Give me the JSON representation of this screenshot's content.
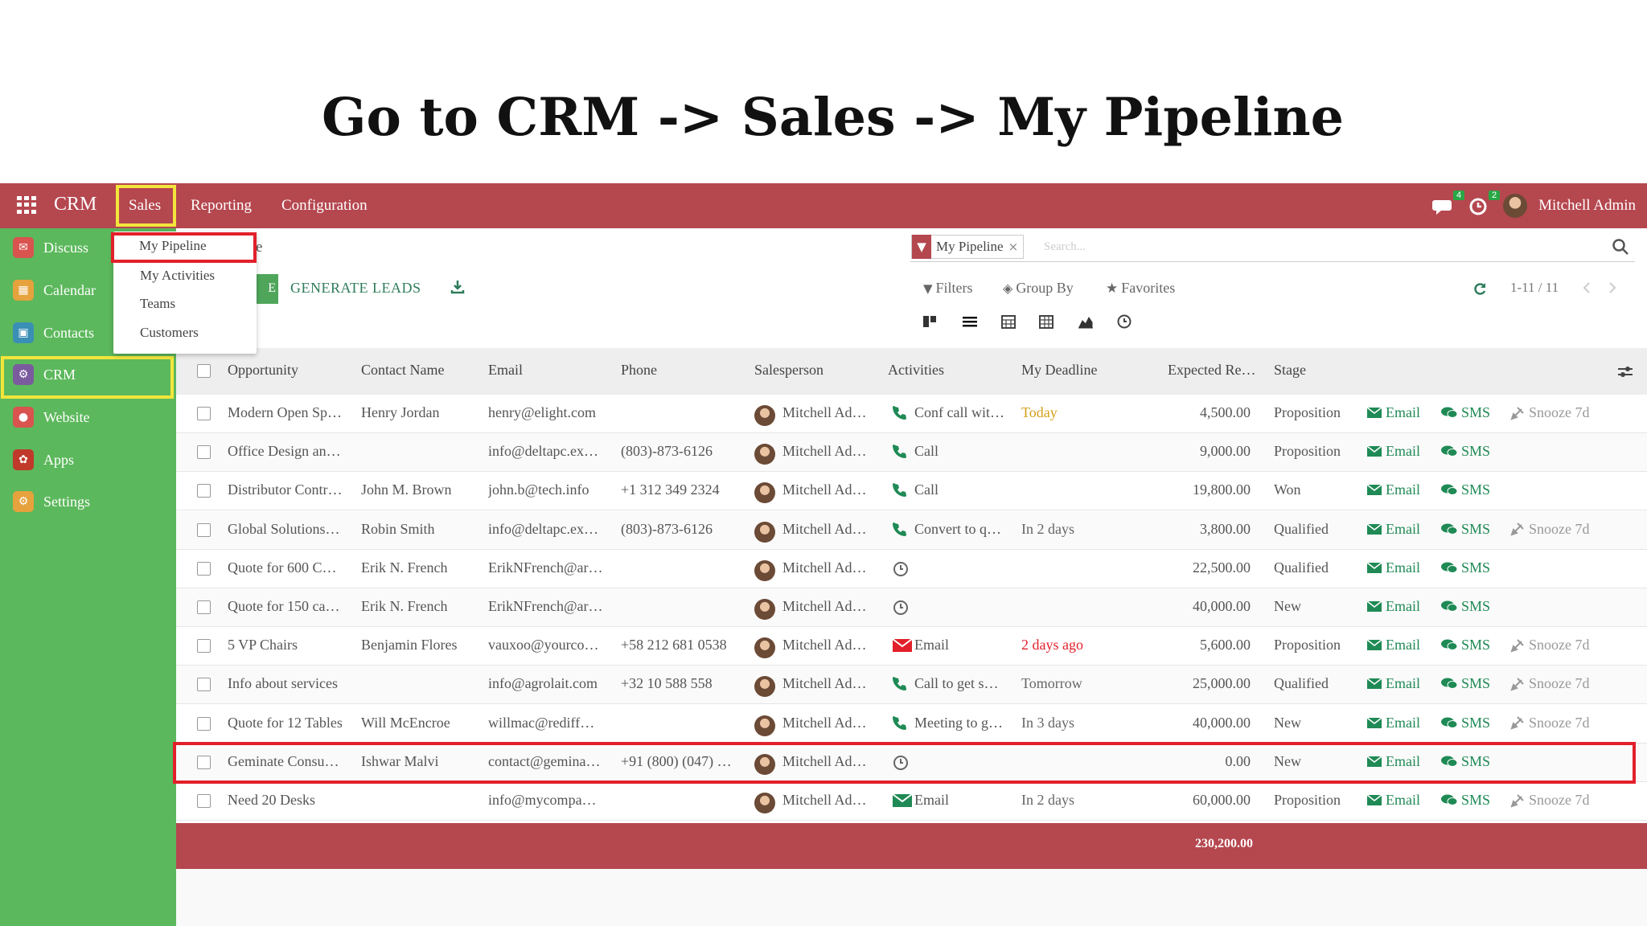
{
  "slide": {
    "title": "Go to CRM -> Sales -> My Pipeline"
  },
  "topbar": {
    "app_name": "CRM",
    "menus": [
      "Sales",
      "Reporting",
      "Configuration"
    ],
    "messages_count": "4",
    "activities_count": "2",
    "user": "Mitchell Admin"
  },
  "dropdown": {
    "items": [
      "My Pipeline",
      "My Activities",
      "Teams",
      "Customers"
    ]
  },
  "sidebar": {
    "items": [
      {
        "label": "Discuss",
        "icon": "discuss-icon",
        "color": "#d9534f"
      },
      {
        "label": "Calendar",
        "icon": "calendar-icon",
        "color": "#e6a23c"
      },
      {
        "label": "Contacts",
        "icon": "contacts-icon",
        "color": "#3a8fb5"
      },
      {
        "label": "CRM",
        "icon": "crm-icon",
        "color": "#7a5c9e"
      },
      {
        "label": "Website",
        "icon": "website-icon",
        "color": "#d9534f"
      },
      {
        "label": "Apps",
        "icon": "apps-icon",
        "color": "#c0392b"
      },
      {
        "label": "Settings",
        "icon": "settings-icon",
        "color": "#e6a23c"
      }
    ]
  },
  "control": {
    "breadcrumb_tail": "e",
    "create_label": "E",
    "generate_leads": "GENERATE LEADS",
    "facet": "My Pipeline",
    "search_placeholder": "Search...",
    "filters": "Filters",
    "group_by": "Group By",
    "favorites": "Favorites",
    "pager": "1-11 / 11"
  },
  "table": {
    "headers": [
      "Opportunity",
      "Contact Name",
      "Email",
      "Phone",
      "Salesperson",
      "Activities",
      "My Deadline",
      "Expected Re…",
      "Stage"
    ],
    "rows": [
      {
        "opportunity": "Modern Open Sp…",
        "contact": "Henry Jordan",
        "email": "henry@elight.com",
        "phone": "",
        "salesperson": "Mitchell Ad…",
        "activity_icon": "phone-icon",
        "activity": "Conf call wit…",
        "deadline": "Today",
        "deadline_color": "#d4a017",
        "revenue": "4,500.00",
        "stage": "Proposition",
        "snooze": "Snooze 7d"
      },
      {
        "opportunity": "Office Design an…",
        "contact": "",
        "email": "info@deltapc.ex…",
        "phone": "(803)-873-6126",
        "salesperson": "Mitchell Ad…",
        "activity_icon": "phone-icon",
        "activity": "Call",
        "deadline": "",
        "deadline_color": "#666666",
        "revenue": "9,000.00",
        "stage": "Proposition",
        "snooze": ""
      },
      {
        "opportunity": "Distributor Contr…",
        "contact": "John M. Brown",
        "email": "john.b@tech.info",
        "phone": "+1 312 349 2324",
        "salesperson": "Mitchell Ad…",
        "activity_icon": "phone-icon",
        "activity": "Call",
        "deadline": "",
        "deadline_color": "#666666",
        "revenue": "19,800.00",
        "stage": "Won",
        "snooze": ""
      },
      {
        "opportunity": "Global Solutions…",
        "contact": "Robin Smith",
        "email": "info@deltapc.ex…",
        "phone": "(803)-873-6126",
        "salesperson": "Mitchell Ad…",
        "activity_icon": "phone-icon",
        "activity": "Convert to q…",
        "deadline": "In 2 days",
        "deadline_color": "#666666",
        "revenue": "3,800.00",
        "stage": "Qualified",
        "snooze": "Snooze 7d"
      },
      {
        "opportunity": "Quote for 600 C…",
        "contact": "Erik N. French",
        "email": "ErikNFrench@ar…",
        "phone": "",
        "salesperson": "Mitchell Ad…",
        "activity_icon": "clock-icon",
        "activity": "",
        "deadline": "",
        "deadline_color": "#666666",
        "revenue": "22,500.00",
        "stage": "Qualified",
        "snooze": ""
      },
      {
        "opportunity": "Quote for 150 ca…",
        "contact": "Erik N. French",
        "email": "ErikNFrench@ar…",
        "phone": "",
        "salesperson": "Mitchell Ad…",
        "activity_icon": "clock-icon",
        "activity": "",
        "deadline": "",
        "deadline_color": "#666666",
        "revenue": "40,000.00",
        "stage": "New",
        "snooze": ""
      },
      {
        "opportunity": "5 VP Chairs",
        "contact": "Benjamin Flores",
        "email": "vauxoo@yourco…",
        "phone": "+58 212 681 0538",
        "salesperson": "Mitchell Ad…",
        "activity_icon": "email-red-icon",
        "activity": "Email",
        "deadline": "2 days ago",
        "deadline_color": "#e2202b",
        "revenue": "5,600.00",
        "stage": "Proposition",
        "snooze": "Snooze 7d"
      },
      {
        "opportunity": "Info about services",
        "contact": "",
        "email": "info@agrolait.com",
        "phone": "+32 10 588 558",
        "salesperson": "Mitchell Ad…",
        "activity_icon": "phone-icon",
        "activity": "Call to get s…",
        "deadline": "Tomorrow",
        "deadline_color": "#666666",
        "revenue": "25,000.00",
        "stage": "Qualified",
        "snooze": "Snooze 7d"
      },
      {
        "opportunity": "Quote for 12 Tables",
        "contact": "Will McEncroe",
        "email": "willmac@rediff…",
        "phone": "",
        "salesperson": "Mitchell Ad…",
        "activity_icon": "phone-icon",
        "activity": "Meeting to g…",
        "deadline": "In 3 days",
        "deadline_color": "#666666",
        "revenue": "40,000.00",
        "stage": "New",
        "snooze": "Snooze 7d"
      },
      {
        "opportunity": "Geminate Consu…",
        "contact": "Ishwar Malvi",
        "email": "contact@gemina…",
        "phone": "+91 (800) (047) …",
        "salesperson": "Mitchell Ad…",
        "activity_icon": "clock-icon",
        "activity": "",
        "deadline": "",
        "deadline_color": "#666666",
        "revenue": "0.00",
        "stage": "New",
        "snooze": ""
      },
      {
        "opportunity": "Need 20 Desks",
        "contact": "",
        "email": "info@mycompa…",
        "phone": "",
        "salesperson": "Mitchell Ad…",
        "activity_icon": "email-green-icon",
        "activity": "Email",
        "deadline": "In 2 days",
        "deadline_color": "#666666",
        "revenue": "60,000.00",
        "stage": "Proposition",
        "snooze": "Snooze 7d"
      }
    ],
    "row_button_email": "Email",
    "row_button_sms": "SMS",
    "total": "230,200.00"
  }
}
